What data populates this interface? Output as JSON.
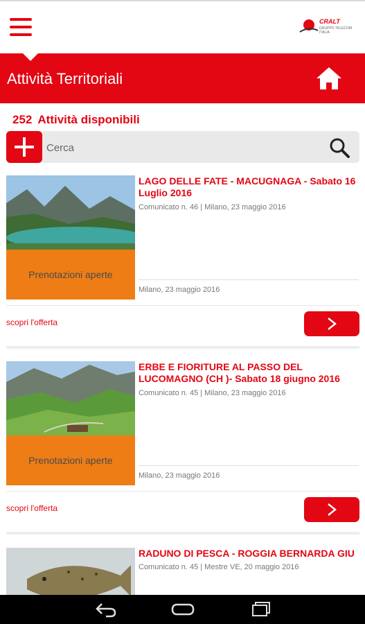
{
  "header": {
    "logo_text": "CRALT",
    "logo_sub": "GRUPPO TELECOM ITALIA"
  },
  "page": {
    "title": "Attività Territoriali"
  },
  "summary": {
    "count": "252",
    "label": "Attività disponibili"
  },
  "search": {
    "placeholder": "Cerca"
  },
  "activities": [
    {
      "title": "LAGO DELLE FATE - MACUGNAGA - Sabato 16 Luglio 2016",
      "communique": "Comunicato n. 46 | Milano, 23 maggio 2016",
      "status": "Prenotazioni aperte",
      "date": "Milano, 23 maggio 2016",
      "offer_label": "scopri l'offerta",
      "image": "mountain-lake"
    },
    {
      "title": "ERBE E FIORITURE AL PASSO DEL LUCOMAGNO (CH )- Sabato 18 giugno 2016",
      "communique": "Comunicato n. 45 | Milano, 23 maggio 2016",
      "status": "Prenotazioni aperte",
      "date": "Milano, 23 maggio 2016",
      "offer_label": "scopri l'offerta",
      "image": "alpine-meadow"
    },
    {
      "title": "RADUNO DI PESCA - ROGGIA BERNARDA GIU",
      "communique": "Comunicato n. 45 | Mestre VE, 20 maggio 2016",
      "image": "trout-fish"
    }
  ],
  "colors": {
    "accent": "#e30613",
    "status_bg": "#ee7d16"
  },
  "icons": [
    "menu-icon",
    "home-icon",
    "plus-icon",
    "search-icon",
    "chevron-right-icon",
    "back-icon",
    "home-nav-icon",
    "recents-icon"
  ]
}
